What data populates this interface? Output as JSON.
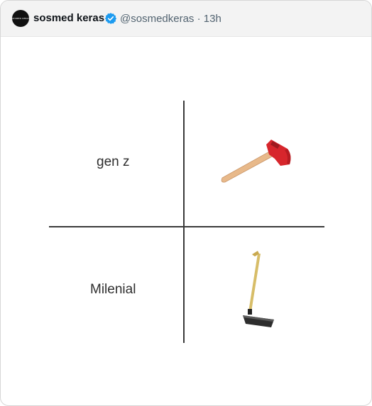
{
  "tweet": {
    "avatar_text": "SOSMED KERAS",
    "author_name": "sosmed keras",
    "handle": "@sosmedkeras",
    "separator": "·",
    "time": "13h"
  },
  "meme": {
    "top_label": "gen z",
    "bottom_label": "Milenial",
    "top_image": "axe-icon",
    "bottom_image": "hoe-icon"
  },
  "colors": {
    "verified": "#1d9bf0",
    "axe_head": "#d7262c",
    "handle_wood": "#e8b98a"
  }
}
